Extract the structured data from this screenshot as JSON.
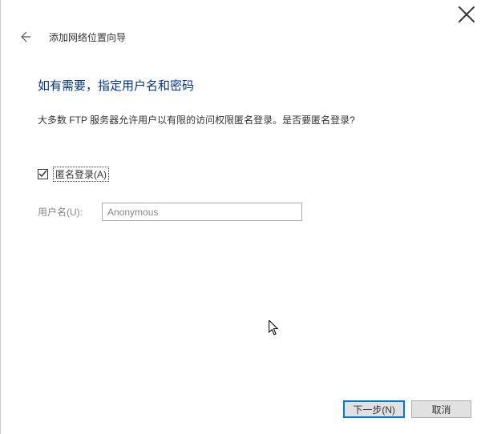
{
  "window": {
    "wizard_title": "添加网络位置向导"
  },
  "content": {
    "heading": "如有需要，指定用户名和密码",
    "description": "大多数 FTP 服务器允许用户以有限的访问权限匿名登录。是否要匿名登录?",
    "anonymous_checkbox_label": "匿名登录(A)",
    "username_label": "用户名(U):",
    "username_value": "Anonymous"
  },
  "footer": {
    "next_label": "下一步(N)",
    "cancel_label": "取消"
  }
}
